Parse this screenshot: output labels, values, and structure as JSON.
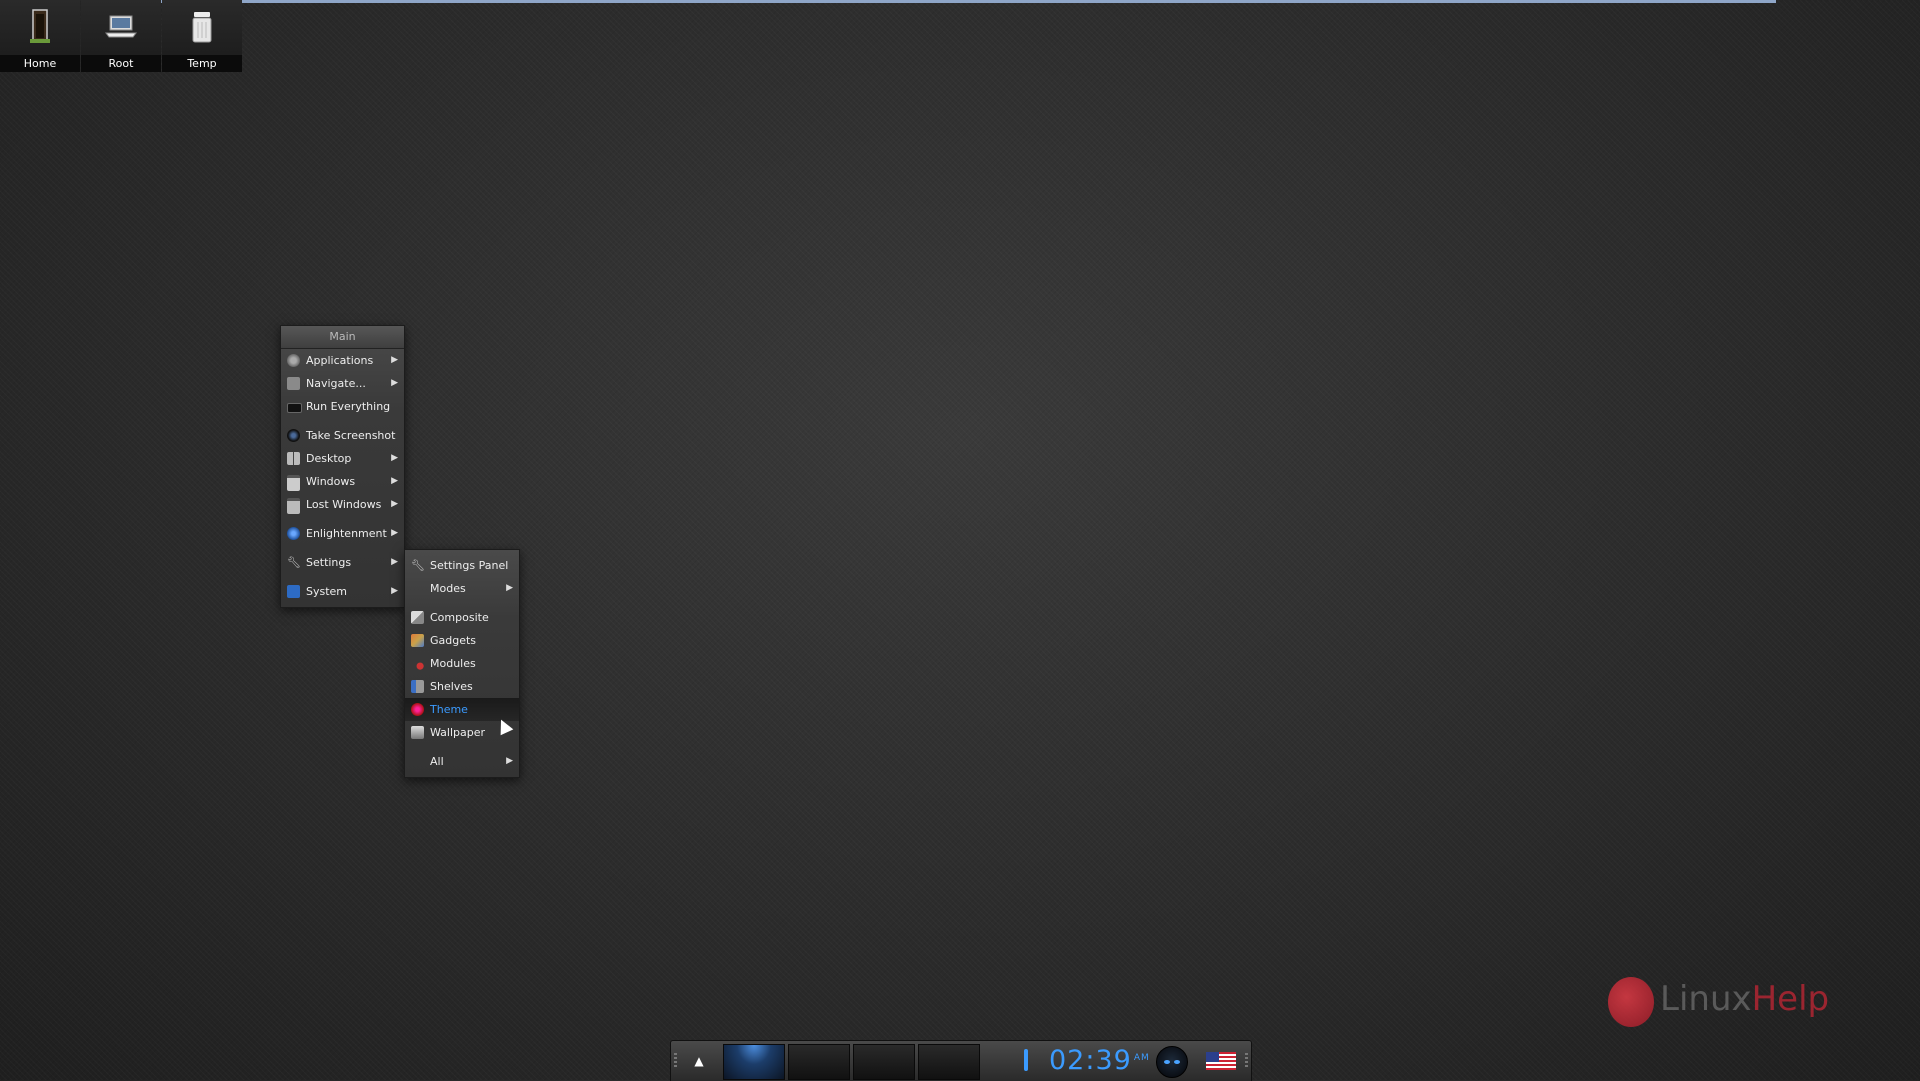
{
  "desktop": {
    "icons": [
      {
        "label": "Home",
        "icon": "door-icon"
      },
      {
        "label": "Root",
        "icon": "laptop-icon"
      },
      {
        "label": "Temp",
        "icon": "bin-icon"
      }
    ]
  },
  "main_menu": {
    "title": "Main",
    "items": [
      {
        "label": "Applications",
        "icon": "applications-icon",
        "submenu": true
      },
      {
        "label": "Navigate...",
        "icon": "folder-icon",
        "submenu": true
      },
      {
        "label": "Run Everything",
        "icon": "terminal-icon",
        "submenu": false
      },
      {
        "label": "Take Screenshot",
        "icon": "camera-icon",
        "submenu": false
      },
      {
        "label": "Desktop",
        "icon": "desktop-icon",
        "submenu": true
      },
      {
        "label": "Windows",
        "icon": "windows-icon",
        "submenu": true
      },
      {
        "label": "Lost Windows",
        "icon": "lost-windows-icon",
        "submenu": true
      },
      {
        "label": "Enlightenment",
        "icon": "enlightenment-icon",
        "submenu": true
      },
      {
        "label": "Settings",
        "icon": "wrench-icon",
        "submenu": true
      },
      {
        "label": "System",
        "icon": "system-icon",
        "submenu": true
      }
    ]
  },
  "settings_menu": {
    "items": [
      {
        "label": "Settings Panel",
        "icon": "wrench-icon",
        "submenu": false
      },
      {
        "label": "Modes",
        "icon": "",
        "submenu": true
      },
      {
        "label": "Composite",
        "icon": "composite-icon",
        "submenu": false
      },
      {
        "label": "Gadgets",
        "icon": "gadgets-icon",
        "submenu": false
      },
      {
        "label": "Modules",
        "icon": "modules-icon",
        "submenu": false
      },
      {
        "label": "Shelves",
        "icon": "shelves-icon",
        "submenu": false
      },
      {
        "label": "Theme",
        "icon": "theme-icon",
        "submenu": false,
        "active": true
      },
      {
        "label": "Wallpaper",
        "icon": "wallpaper-icon",
        "submenu": false
      },
      {
        "label": "All",
        "icon": "",
        "submenu": true
      }
    ]
  },
  "shelf": {
    "clock_time": "02:39",
    "clock_ampm": "AM",
    "active_desktop": 1,
    "desktop_count": 4
  },
  "watermark": {
    "brand_a": "Linux",
    "brand_b": "Help"
  },
  "colors": {
    "accent": "#3b9bff",
    "menu_bg": "#3a3a3a",
    "watermark_red": "#9b2530"
  }
}
